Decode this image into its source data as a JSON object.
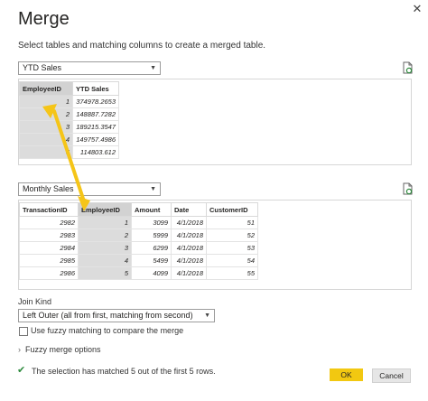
{
  "window": {
    "title": "Merge",
    "subtitle": "Select tables and matching columns to create a merged table."
  },
  "table1": {
    "selected": "YTD Sales",
    "headers": [
      "EmployeeID",
      "YTD Sales"
    ],
    "rows": [
      [
        "1",
        "374978.2653"
      ],
      [
        "2",
        "148887.7282"
      ],
      [
        "3",
        "189215.3547"
      ],
      [
        "4",
        "149757.4986"
      ],
      [
        "5",
        "114803.612"
      ]
    ]
  },
  "table2": {
    "selected": "Monthly Sales",
    "headers": [
      "TransactionID",
      "EmployeeID",
      "Amount",
      "Date",
      "CustomerID"
    ],
    "rows": [
      [
        "2982",
        "1",
        "3099",
        "4/1/2018",
        "51"
      ],
      [
        "2983",
        "2",
        "5999",
        "4/1/2018",
        "52"
      ],
      [
        "2984",
        "3",
        "6299",
        "4/1/2018",
        "53"
      ],
      [
        "2985",
        "4",
        "5499",
        "4/1/2018",
        "54"
      ],
      [
        "2986",
        "5",
        "4099",
        "4/1/2018",
        "55"
      ]
    ]
  },
  "join": {
    "label": "Join Kind",
    "selected": "Left Outer (all from first, matching from second)",
    "fuzzy_checkbox_label": "Use fuzzy matching to compare the merge",
    "fuzzy_options_label": "Fuzzy merge options"
  },
  "status": {
    "text": "The selection has matched 5 out of the first 5 rows."
  },
  "buttons": {
    "ok": "OK",
    "cancel": "Cancel"
  },
  "colors": {
    "accent_yellow": "#f2c811",
    "arrow": "#f5c518",
    "check_green": "#2e8b3e",
    "selected_column": "#dcdcdc"
  },
  "icons": {
    "close": "close-icon",
    "refresh": "refresh-icon",
    "check": "checkmark-icon",
    "expander": "chevron-right-icon",
    "dropdown": "chevron-down-icon"
  }
}
